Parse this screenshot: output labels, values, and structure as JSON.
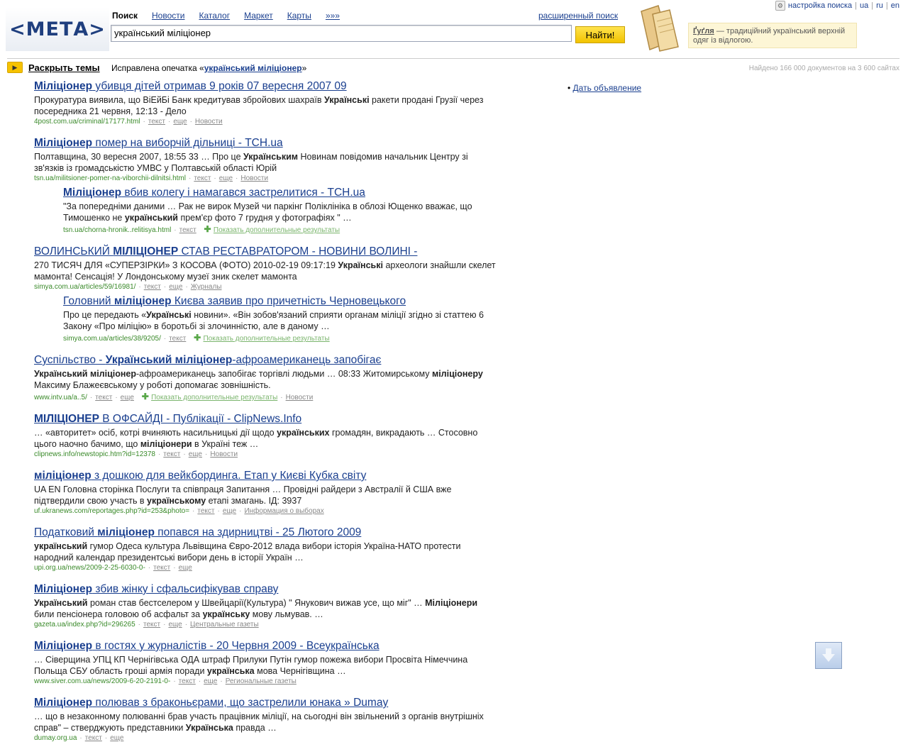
{
  "header": {
    "logo": "<МЕТА>",
    "nav": [
      {
        "label": "Поиск",
        "active": true
      },
      {
        "label": "Новости"
      },
      {
        "label": "Каталог"
      },
      {
        "label": "Маркет"
      },
      {
        "label": "Карты"
      },
      {
        "label": "»»»"
      }
    ],
    "advanced_search": "расширенный поиск",
    "search_value": "український міліціонер",
    "search_button": "Найти!",
    "tip": {
      "term": "Ґуґля",
      "text": "— традиційний український верхній одяг із відлогою."
    },
    "settings": {
      "label": "настройка поиска",
      "langs": [
        "ua",
        "ru",
        "en"
      ]
    }
  },
  "themes_label": "Раскрыть темы",
  "correction": {
    "prefix": "Исправлена опечатка «",
    "term": "український міліціонер",
    "suffix": "»"
  },
  "found": "Найдено 166 000 документов на 3 600 сайтах",
  "ad_link": "Дать объявление",
  "colors": {
    "link": "#1a3f8f",
    "url": "#3a8a2a",
    "button": "#f6c200"
  },
  "results": [
    {
      "title_bold": "Міліціонер",
      "title_rest": " убивця дітей отримав 9 років 07 вересня 2007 09",
      "snippet": [
        [
          "Прокуратура виявила, що ВіЕйБі Банк кредитував збройових шахраїв ",
          false
        ],
        [
          "Українські",
          true
        ],
        [
          " ракети продані Грузії через посередника 21 червня, 12:13 - Дело",
          false
        ]
      ],
      "url": "4post.com.ua/criminal/17177.html",
      "links": [
        "текст",
        "еще",
        "Новости"
      ]
    },
    {
      "title_bold": "Міліціонер",
      "title_rest": " помер на виборчій дільниці - ТСН.ua",
      "snippet": [
        [
          "Полтавщина, 30 вересня 2007, 18:55 33 … Про це ",
          false
        ],
        [
          "Українським",
          true
        ],
        [
          " Новинам повідомив начальник Центру зі зв'язків із громадськістю УМВС у Полтавській області Юрій",
          false
        ]
      ],
      "url": "tsn.ua/militsioner-pomer-na-viborchii-dilnitsi.html",
      "links": [
        "текст",
        "еще",
        "Новости"
      ]
    },
    {
      "title_bold": "Міліціонер",
      "title_rest": " вбив колегу і намагався застрелитися - ТСН.ua",
      "snippet": [
        [
          "\"За попередніми даними … Рак не вирок Музей чи паркінг Поліклініка в облозі Ющенко вважає, що Тимошенко не ",
          false
        ],
        [
          "український",
          true
        ],
        [
          " прем'єр фото 7 грудня у фотографіях \" …",
          false
        ]
      ],
      "url": "tsn.ua/chorna-hronik..relitisya.html",
      "links": [
        "текст"
      ],
      "more": "Показать дополнительные результаты"
    },
    {
      "title_pre": "ВОЛИНСЬКИЙ ",
      "title_bold": "МІЛІЦІОНЕР",
      "title_rest": " СТАВ РЕСТАВРАТОРОМ - НОВИНИ ВОЛИНІ -",
      "snippet": [
        [
          "270 ТИСЯЧ ДЛЯ «СУПЕРЗІРКИ» З КОСОВА (ФОТО) 2010-02-19 09:17:19 ",
          false
        ],
        [
          "Українські",
          true
        ],
        [
          " археологи знайшли скелет мамонта! Сенсація! У Лондонському музеї зник скелет мамонта",
          false
        ]
      ],
      "url": "simya.com.ua/articles/59/16981/",
      "links": [
        "текст",
        "еще",
        "Журналы"
      ]
    },
    {
      "title_pre": "Головний ",
      "title_bold": "міліціонер",
      "title_rest": " Києва заявив про причетність Черновецького",
      "snippet": [
        [
          "Про це передають «",
          false
        ],
        [
          "Українські",
          true
        ],
        [
          " новини». «Він зобов'язаний сприяти органам міліції згідно зі статтею 6 Закону «Про міліцію» в боротьбі зі злочинністю, але в даному …",
          false
        ]
      ],
      "url": "simya.com.ua/articles/38/9205/",
      "links": [
        "текст"
      ],
      "more": "Показать дополнительные результаты"
    },
    {
      "title_pre": "Суспільство - ",
      "title_bold": "Український міліціонер",
      "title_rest": "-афроамериканець запобігає",
      "snippet": [
        [
          "Український міліціонер",
          true
        ],
        [
          "-афроамериканець запобігає торгівлі людьми … 08:33 Житомирському ",
          false
        ],
        [
          "міліціонеру",
          true
        ],
        [
          " Максиму Блажеєвському у роботі допомагає зовнішність.",
          false
        ]
      ],
      "url": "www.intv.ua/a..5/",
      "links": [
        "текст",
        "еще"
      ],
      "more": "Показать дополнительные результаты",
      "tail_link": "Новости"
    },
    {
      "title_bold": "МІЛІЦІОНЕР",
      "title_rest": " В ОФСАЙДІ - Публікації - ClipNews.Info",
      "snippet": [
        [
          "… «авторитет» осіб, котрі вчиняють насильницькі дії щодо ",
          false
        ],
        [
          "українських",
          true
        ],
        [
          " громадян, викрадають … Стосовно цього наочно бачимо, що ",
          false
        ],
        [
          "міліціонери",
          true
        ],
        [
          " в Україні теж …",
          false
        ]
      ],
      "url": "clipnews.info/newstopic.htm?id=12378",
      "links": [
        "текст",
        "еще",
        "Новости"
      ]
    },
    {
      "title_bold": "міліціонер",
      "title_rest": " з дошкою для вейкбординга. Етап у Києві Кубка світу",
      "snippet": [
        [
          "UA EN Головна сторінка Послуги та співпраця Запитання … Провідні райдери з Австралії й США вже підтвердили свою участь в ",
          false
        ],
        [
          "українському",
          true
        ],
        [
          " етапі змагань. ІД: 3937",
          false
        ]
      ],
      "url": "uf.ukranews.com/reportages.php?id=253&photo=",
      "links": [
        "текст",
        "еще",
        "Информация о выборах"
      ]
    },
    {
      "title_pre": "Податковий ",
      "title_bold": "міліціонер",
      "title_rest": " попався на здирництві - 25 Лютого 2009",
      "snippet": [
        [
          "український",
          true
        ],
        [
          " гумор Одеса культура Львівщина Євро-2012 влада вибори історія Україна-НАТО протести народний календар президентські вибори день в історії Україн …",
          false
        ]
      ],
      "url": "upi.org.ua/news/2009-2-25-6030-0-",
      "links": [
        "текст",
        "еще"
      ]
    },
    {
      "title_bold": "Міліціонер",
      "title_rest": " збив жінку і сфальсифікував справу",
      "snippet": [
        [
          "Український",
          true
        ],
        [
          " роман став бестселером у Швейцарії(Культура) \" Янукович вижав усе, що міг\" … ",
          false
        ],
        [
          "Міліціонери",
          true
        ],
        [
          " били пенсіонера головою об асфальт за ",
          false
        ],
        [
          "українську",
          true
        ],
        [
          " мову льмував. …",
          false
        ]
      ],
      "url": "gazeta.ua/index.php?id=296265",
      "links": [
        "текст",
        "еще",
        "Центральные газеты"
      ]
    },
    {
      "title_bold": "Міліціонер",
      "title_rest": " в гостях у журналістів - 20 Червня 2009 - Всеукраїнська",
      "snippet": [
        [
          "… Сіверщина УПЦ КП Чернігівська ОДА штраф Прилуки Путін гумор пожежа вибори Просвіта Німеччина Польща СБУ область гроші армія поради ",
          false
        ],
        [
          "українська",
          true
        ],
        [
          " мова Чернігівщина …",
          false
        ]
      ],
      "url": "www.siver.com.ua/news/2009-6-20-2191-0-",
      "links": [
        "текст",
        "еще",
        "Региональные газеты"
      ]
    },
    {
      "title_bold": "Міліціонер",
      "title_rest": " полював з браконьєрами, що застрелили юнака » Dumay",
      "snippet": [
        [
          "… що в незаконному полюванні брав участь працівник міліції, на сьогодні він звільнений з органів внутрішніх справ\" – стверджують представники ",
          false
        ],
        [
          "Українська",
          true
        ],
        [
          " правда …",
          false
        ]
      ],
      "url": "dumay.org.ua",
      "links": [
        "текст",
        "еще"
      ]
    }
  ]
}
